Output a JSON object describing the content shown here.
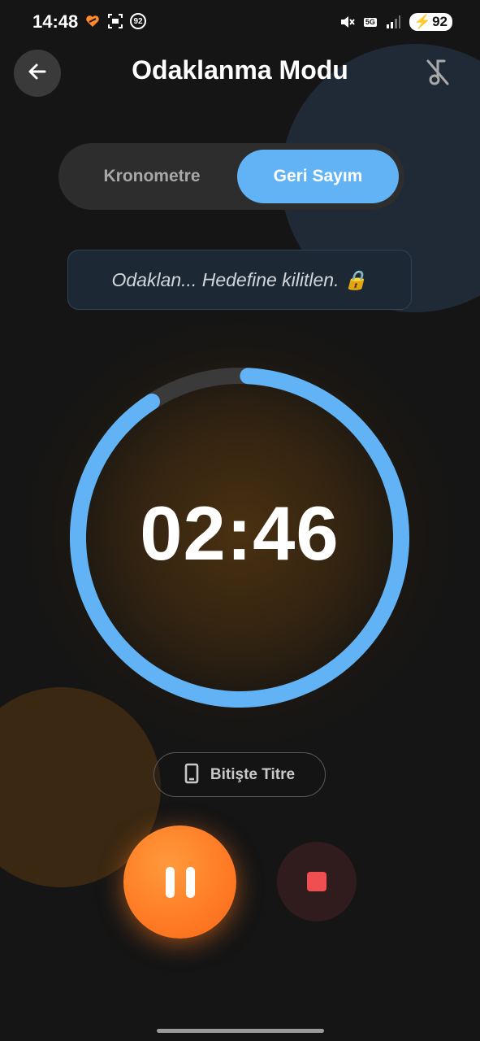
{
  "status_bar": {
    "time": "14:48",
    "notification_badge": "92",
    "network": "5G",
    "battery": "92"
  },
  "header": {
    "title": "Odaklanma Modu",
    "back_icon": "arrow-left-icon",
    "music_icon": "music-off-icon"
  },
  "mode_toggle": {
    "tabs": [
      {
        "label": "Kronometre",
        "active": false
      },
      {
        "label": "Geri Sayım",
        "active": true
      }
    ]
  },
  "quote": {
    "text": "Odaklan... Hedefine kilitlen. 🔒"
  },
  "timer": {
    "display": "02:46",
    "progress": 0.9
  },
  "vibrate": {
    "label": "Bitişte Titre",
    "icon": "phone-vibrate-icon"
  },
  "controls": {
    "pause_icon": "pause-icon",
    "stop_icon": "stop-icon"
  },
  "colors": {
    "background": "#151515",
    "accent_blue": "#62b3f6",
    "accent_orange": "#ff7a24",
    "stop_red": "#ef4f51"
  }
}
